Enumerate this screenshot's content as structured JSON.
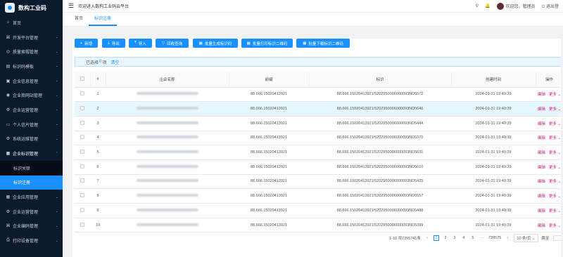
{
  "app": {
    "title": "数构工业码",
    "welcome": "欢迎进入数构工业码云平台",
    "user": "欢迎您，管理员",
    "logout": "退出登"
  },
  "tabs": [
    {
      "label": "首页"
    },
    {
      "label": "标识注册"
    }
  ],
  "sidebar": {
    "items": [
      {
        "label": "首页",
        "icon": "home-icon"
      },
      {
        "label": "开发平台管理",
        "icon": "code-icon"
      },
      {
        "label": "质量索帽管理",
        "icon": "quality-icon"
      },
      {
        "label": "标识码模板",
        "icon": "template-icon"
      },
      {
        "label": "企业信息管理",
        "icon": "building-icon"
      },
      {
        "label": "企业商网站管理",
        "icon": "website-icon"
      },
      {
        "label": "企业运营管理",
        "icon": "operation-icon"
      },
      {
        "label": "个人信片管理",
        "icon": "card-icon"
      },
      {
        "label": "系统运维管理",
        "icon": "settings-icon"
      },
      {
        "label": "企业标识管理",
        "icon": "identity-icon"
      }
    ],
    "sub_items": [
      {
        "label": "标识关联"
      },
      {
        "label": "标识注册"
      }
    ],
    "bottom_items": [
      {
        "label": "企业应用管理",
        "icon": "app-icon"
      },
      {
        "label": "企业运营管理",
        "icon": "operation-icon"
      },
      {
        "label": "企业编码管理",
        "icon": "code-icon"
      },
      {
        "label": "打印设备管理",
        "icon": "printer-icon"
      }
    ]
  },
  "toolbar": {
    "add": "新增",
    "export": "导出",
    "import": "导入",
    "reset": "回收查询",
    "batch_gen": "批量生成标识码",
    "batch_print": "批量打印标识二维码",
    "batch_download": "批量下载标识二维码"
  },
  "selection": {
    "prefix": "已选择",
    "count": "0",
    "suffix": "项",
    "clear": "清空"
  },
  "table": {
    "headers": [
      "#",
      "企业名称",
      "前缀",
      "标识",
      "创建时间",
      "操作"
    ],
    "edit_label": "编辑",
    "more_label": "更多",
    "rows": [
      {
        "no": "1",
        "prefix": "88.666.15020413921",
        "id": "88.666.15020413921/5202950006000093ND5572",
        "time": "2024-01-31 19:40:39"
      },
      {
        "no": "2",
        "prefix": "88.666.15020413921",
        "id": "88.666.15020413921/5202950006000093ND5646",
        "time": "2024-01-31 19:40:39"
      },
      {
        "no": "3",
        "prefix": "88.666.15020413921",
        "id": "88.666.15020413921/5202950006000093ND5444",
        "time": "2024-01-31 19:40:39"
      },
      {
        "no": "4",
        "prefix": "88.666.15020413921",
        "id": "88.666.15020413921/5202950006000093ND5370",
        "time": "2024-01-31 19:40:39"
      },
      {
        "no": "5",
        "prefix": "88.666.15020413921",
        "id": "88.666.15020413921/5202950006000093ND5631",
        "time": "2024-01-31 19:40:39"
      },
      {
        "no": "6",
        "prefix": "88.666.15020413921",
        "id": "88.666.15020413921/5202950006000093ND5610",
        "time": "2024-01-31 19:40:39"
      },
      {
        "no": "7",
        "prefix": "88.666.15020413921",
        "id": "88.666.15020413921/5202950006000093ND5425",
        "time": "2024-01-31 19:40:39"
      },
      {
        "no": "8",
        "prefix": "88.666.15020413921",
        "id": "88.666.15020413921/5202950006000093ND5557",
        "time": "2024-01-31 19:40:39"
      },
      {
        "no": "9",
        "prefix": "88.666.15020413921",
        "id": "88.666.15020413921/5202950006000093ND5488",
        "time": "2024-01-31 19:40:39"
      },
      {
        "no": "10",
        "prefix": "88.666.15020413921",
        "id": "88.666.15020413921/5202950006000093ND5399",
        "time": "2024-01-31 19:40:39"
      }
    ]
  },
  "pagination": {
    "total": "1-10 共7395741条",
    "pages": [
      "1",
      "2",
      "3",
      "4",
      "5"
    ],
    "last": "739575",
    "page_size": "10 条/页",
    "goto": "跳至"
  },
  "colors": {
    "primary": "#1890ff",
    "sidebar": "#0c1a30",
    "action": "#c41d7f"
  }
}
